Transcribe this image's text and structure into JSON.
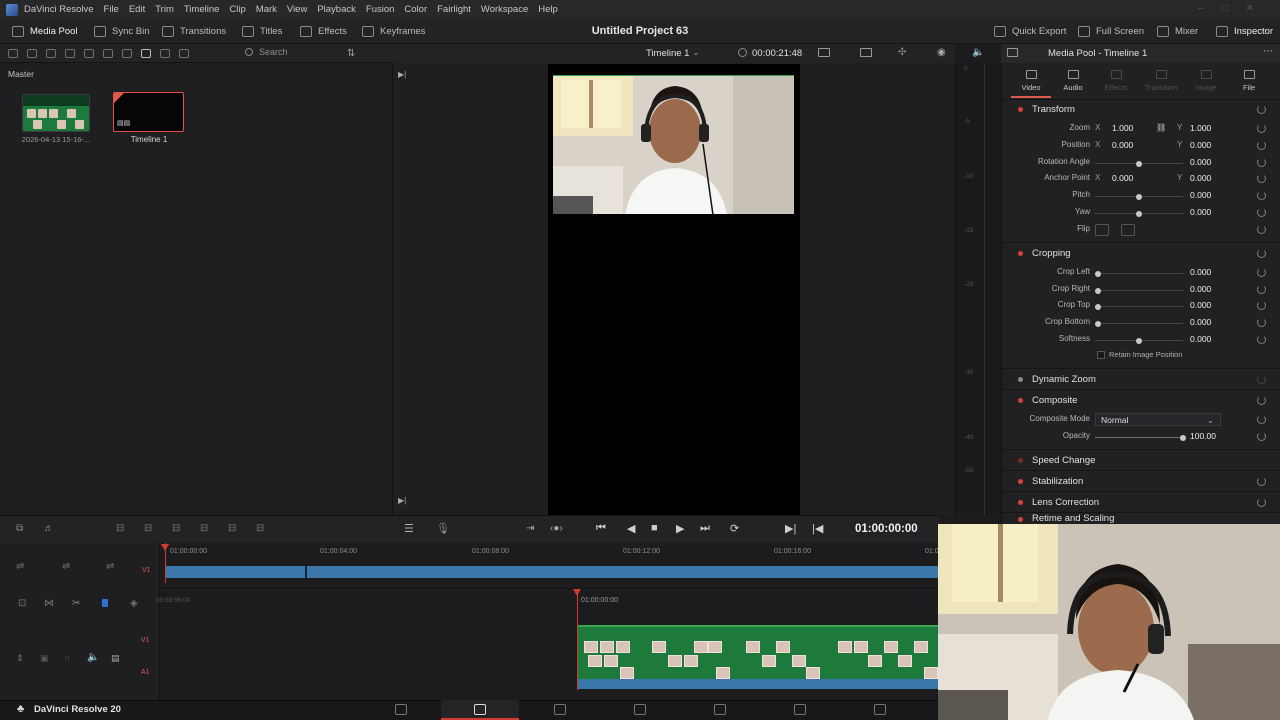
{
  "app": {
    "name": "DaVinci Resolve",
    "menu": [
      "File",
      "Edit",
      "Trim",
      "Timeline",
      "Clip",
      "Mark",
      "View",
      "Playback",
      "Fusion",
      "Color",
      "Fairlight",
      "Workspace",
      "Help"
    ]
  },
  "toolbar": {
    "left": [
      {
        "label": "Media Pool",
        "icon": "media-pool-icon"
      },
      {
        "label": "Sync Bin",
        "icon": "sync-bin-icon"
      },
      {
        "label": "Transitions",
        "icon": "transitions-icon"
      },
      {
        "label": "Titles",
        "icon": "titles-icon"
      },
      {
        "label": "Effects",
        "icon": "effects-icon"
      },
      {
        "label": "Keyframes",
        "icon": "keyframes-icon"
      }
    ],
    "project_title": "Untitled Project 63",
    "right": [
      {
        "label": "Quick Export",
        "icon": "export-icon"
      },
      {
        "label": "Full Screen",
        "icon": "fullscreen-icon"
      },
      {
        "label": "Mixer",
        "icon": "mixer-icon"
      },
      {
        "label": "Inspector",
        "icon": "inspector-icon"
      }
    ]
  },
  "media_pool": {
    "search_placeholder": "Search",
    "bin_label": "Master",
    "items": [
      {
        "label": "2026-04-13 15-16-..."
      },
      {
        "label": "Timeline 1"
      }
    ]
  },
  "viewer": {
    "timeline_name": "Timeline 1",
    "duration": "00:00:21:48"
  },
  "meters": {
    "ticks": [
      "0",
      "-5",
      "-10",
      "-15",
      "-20",
      "-30",
      "-40",
      "-50"
    ]
  },
  "inspector": {
    "title": "Media Pool - Timeline 1",
    "tabs": [
      {
        "label": "Video",
        "enabled": true
      },
      {
        "label": "Audio",
        "enabled": true
      },
      {
        "label": "Effects",
        "enabled": false
      },
      {
        "label": "Transition",
        "enabled": false
      },
      {
        "label": "Image",
        "enabled": false
      },
      {
        "label": "File",
        "enabled": true
      }
    ],
    "transform": {
      "title": "Transform",
      "zoom": {
        "label": "Zoom",
        "x": "1.000",
        "y": "1.000"
      },
      "position": {
        "label": "Position",
        "x": "0.000",
        "y": "0.000"
      },
      "rotation": {
        "label": "Rotation Angle",
        "value": "0.000"
      },
      "anchor": {
        "label": "Anchor Point",
        "x": "0.000",
        "y": "0.000"
      },
      "pitch": {
        "label": "Pitch",
        "value": "0.000"
      },
      "yaw": {
        "label": "Yaw",
        "value": "0.000"
      },
      "flip": {
        "label": "Flip"
      }
    },
    "cropping": {
      "title": "Cropping",
      "left": {
        "label": "Crop Left",
        "value": "0.000"
      },
      "right": {
        "label": "Crop Right",
        "value": "0.000"
      },
      "top": {
        "label": "Crop Top",
        "value": "0.000"
      },
      "bottom": {
        "label": "Crop Bottom",
        "value": "0.000"
      },
      "softness": {
        "label": "Softness",
        "value": "0.000"
      },
      "retain": "Retain Image Position"
    },
    "dynamic_zoom": "Dynamic Zoom",
    "composite": {
      "title": "Composite",
      "mode_label": "Composite Mode",
      "mode_value": "Normal",
      "opacity_label": "Opacity",
      "opacity_value": "100.00"
    },
    "speed_change": "Speed Change",
    "stabilization": "Stabilization",
    "lens_correction": "Lens Correction",
    "retime": "Retime and Scaling"
  },
  "transport": {
    "timecode": "01:00:00:00"
  },
  "timeline": {
    "upper_ruler": [
      "01:00:00:00",
      "01:00:04:00",
      "01:00:08:00",
      "01:00:12:00",
      "01:00:16:00",
      "01:0"
    ],
    "lower_ruler": [
      "00:59:56:00",
      "01:00:00:00"
    ],
    "tracks": {
      "v1": "V1",
      "a1": "A1"
    }
  },
  "footer": {
    "brand": "DaVinci Resolve 20"
  },
  "colors": {
    "accent": "#d03a30",
    "clip_green": "#1e7a3a",
    "clip_blue": "#3b76a8"
  }
}
